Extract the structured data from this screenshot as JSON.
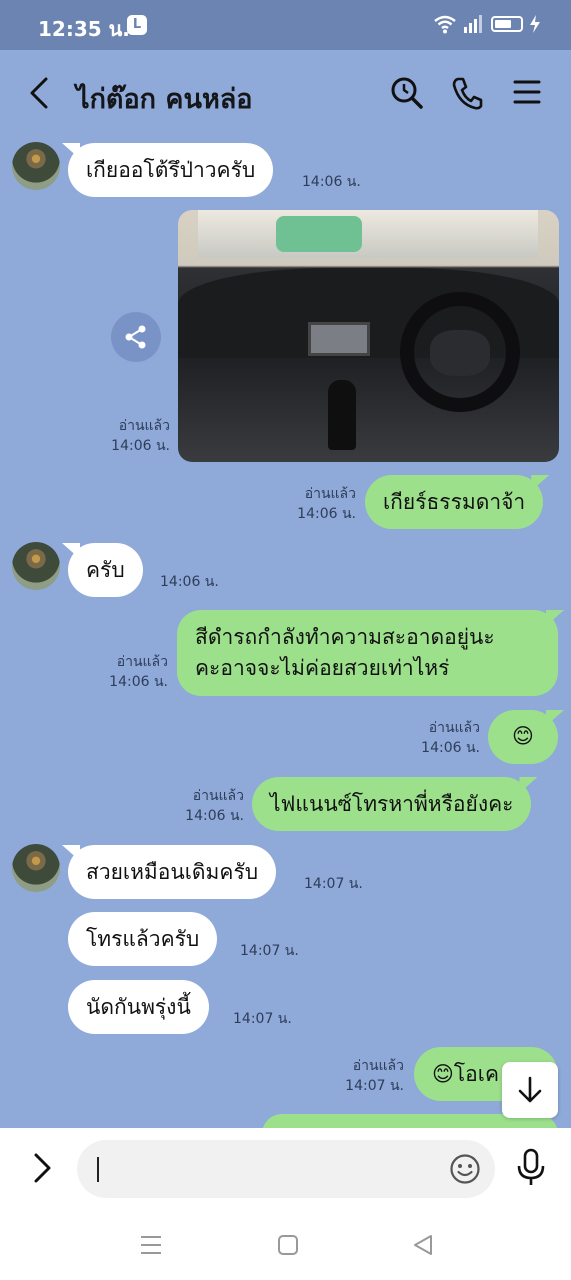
{
  "status_bar": {
    "time": "12:35 น.",
    "app_badge": "L"
  },
  "header": {
    "contact_name": "ไก่ต๊อก คนหล่อ"
  },
  "messages": [
    {
      "text": "เกียออโต้รึป่าวครับ",
      "time": "14:06 น."
    },
    {
      "read": "อ่านแล้ว",
      "time": "14:06 น."
    },
    {
      "text": "เกียร์ธรรมดาจ้า",
      "read": "อ่านแล้ว",
      "time": "14:06 น."
    },
    {
      "text": "ครับ",
      "time": "14:06 น."
    },
    {
      "line1": "สีดำรถกำลังทำความสะอาดอยู่นะ",
      "line2": "คะอาจจะไม่ค่อยสวยเท่าไหร่",
      "read": "อ่านแล้ว",
      "time": "14:06 น."
    },
    {
      "text": "😊",
      "read": "อ่านแล้ว",
      "time": "14:06 น."
    },
    {
      "text": "ไฟแนนซ์โทรหาพี่หรือยังคะ",
      "read": "อ่านแล้ว",
      "time": "14:06 น."
    },
    {
      "text": "สวยเหมือนเดิมครับ",
      "time": "14:07 น."
    },
    {
      "text": "โทรแล้วครับ",
      "time": "14:07 น."
    },
    {
      "text": "นัดกันพรุ่งนี้",
      "time": "14:07 น."
    },
    {
      "text": "😊โอเค",
      "read": "อ่านแล้ว",
      "time": "14:07 น."
    }
  ],
  "input": {
    "value": "",
    "placeholder": ""
  }
}
